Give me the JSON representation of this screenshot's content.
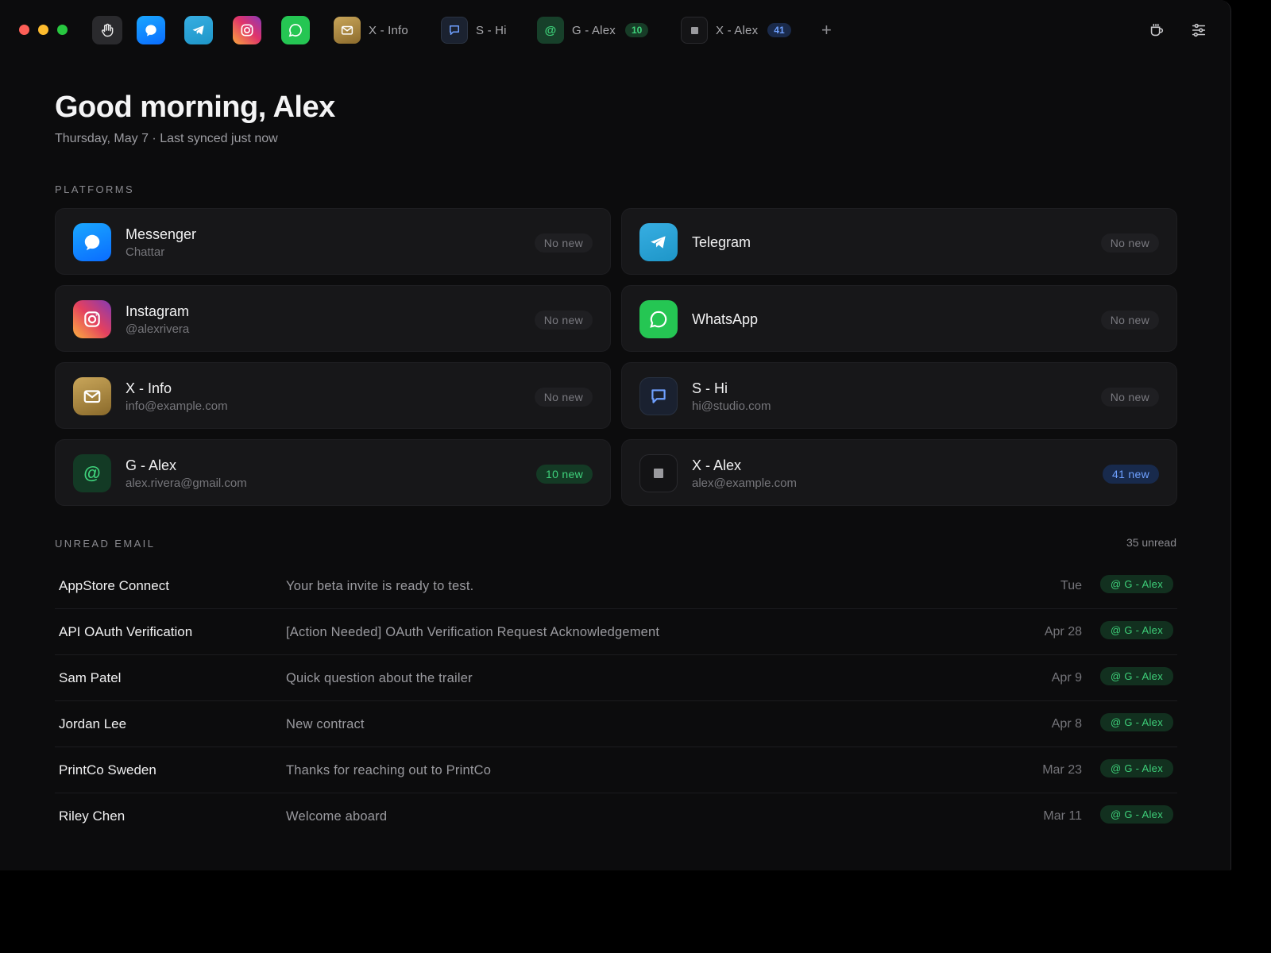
{
  "titlebar": {
    "tabs": [
      {
        "label": "X - Info"
      },
      {
        "label": "S - Hi"
      },
      {
        "label": "G - Alex",
        "badge": "10",
        "at_symbol": "@"
      },
      {
        "label": "X - Alex",
        "badge": "41"
      }
    ],
    "add_tab": "+",
    "icons": [
      "hand-icon",
      "messenger-icon",
      "telegram-icon",
      "instagram-icon",
      "whatsapp-icon",
      "coffee-cup-icon",
      "sliders-icon"
    ]
  },
  "greeting": {
    "title": "Good morning, Alex",
    "subtitle": "Thursday, May 7 · Last synced just now"
  },
  "platforms": {
    "label": "PLATFORMS",
    "cards": [
      {
        "name": "Messenger",
        "sub": "Chattar",
        "status": "No new"
      },
      {
        "name": "Telegram",
        "sub": "",
        "status": "No new"
      },
      {
        "name": "Instagram",
        "sub": "@alexrivera",
        "status": "No new"
      },
      {
        "name": "WhatsApp",
        "sub": "",
        "status": "No new"
      },
      {
        "name": "X - Info",
        "sub": "info@example.com",
        "status": "No new"
      },
      {
        "name": "S - Hi",
        "sub": "hi@studio.com",
        "status": "No new"
      },
      {
        "name": "G - Alex",
        "sub": "alex.rivera@gmail.com",
        "status": "10 new",
        "icon_text": "@"
      },
      {
        "name": "X - Alex",
        "sub": "alex@example.com",
        "status": "41 new"
      }
    ]
  },
  "unread": {
    "label": "UNREAD EMAIL",
    "count": "35 unread",
    "rows": [
      {
        "sender": "AppStore Connect",
        "subject": "Your beta invite is ready to test.",
        "date": "Tue",
        "account": "@ G - Alex"
      },
      {
        "sender": "API OAuth Verification",
        "subject": "[Action Needed] OAuth Verification Request Acknowledgement",
        "date": "Apr 28",
        "account": "@ G - Alex"
      },
      {
        "sender": "Sam Patel",
        "subject": "Quick question about the trailer",
        "date": "Apr 9",
        "account": "@ G - Alex"
      },
      {
        "sender": "Jordan Lee",
        "subject": "New contract",
        "date": "Apr 8",
        "account": "@ G - Alex"
      },
      {
        "sender": "PrintCo Sweden",
        "subject": "Thanks for reaching out to PrintCo",
        "date": "Mar 23",
        "account": "@ G - Alex"
      },
      {
        "sender": "Riley Chen",
        "subject": "Welcome aboard",
        "date": "Mar 11",
        "account": "@ G - Alex"
      }
    ]
  },
  "colors": {
    "background": "#0c0c0d",
    "card": "#171719",
    "accent_green": "#3ed27a",
    "accent_blue": "#6fa0ff"
  }
}
